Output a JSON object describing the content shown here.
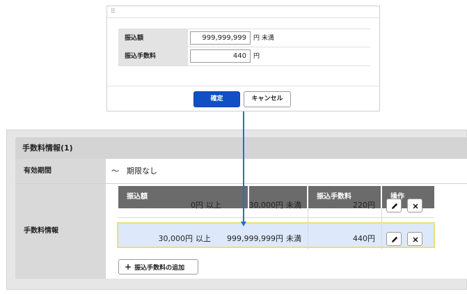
{
  "dialog": {
    "drag_handle_icon": "drag-handle-icon",
    "fields": [
      {
        "label": "振込額",
        "value": "999,999,999",
        "unit": "円 未満"
      },
      {
        "label": "振込手数料",
        "value": "440",
        "unit": "円"
      }
    ],
    "confirm_label": "確定",
    "cancel_label": "キャンセル",
    "confirm_color": "#1150c4"
  },
  "panel": {
    "title": "手数料情報(1)",
    "valid_period_label": "有効期間",
    "valid_period_value": "～　期限なし",
    "fee_info_label": "手数料情報",
    "table": {
      "headers": [
        "振込額",
        "振込手数料",
        "操作"
      ],
      "rows": [
        {
          "from": "0円",
          "from_suffix": "以上",
          "to": "30,000円",
          "to_suffix": "未満",
          "fee": "220円",
          "highlighted": false
        },
        {
          "from": "30,000円",
          "from_suffix": "以上",
          "to": "999,999,999円",
          "to_suffix": "未満",
          "fee": "440円",
          "highlighted": true
        }
      ]
    },
    "add_button_label": "振込手数料の追加",
    "edit_icon": "pencil-icon",
    "delete_icon": "close-icon",
    "highlight_color": "#dde9fb",
    "highlight_border": "#f1dc7a"
  },
  "connector_color": "#1d73c6"
}
